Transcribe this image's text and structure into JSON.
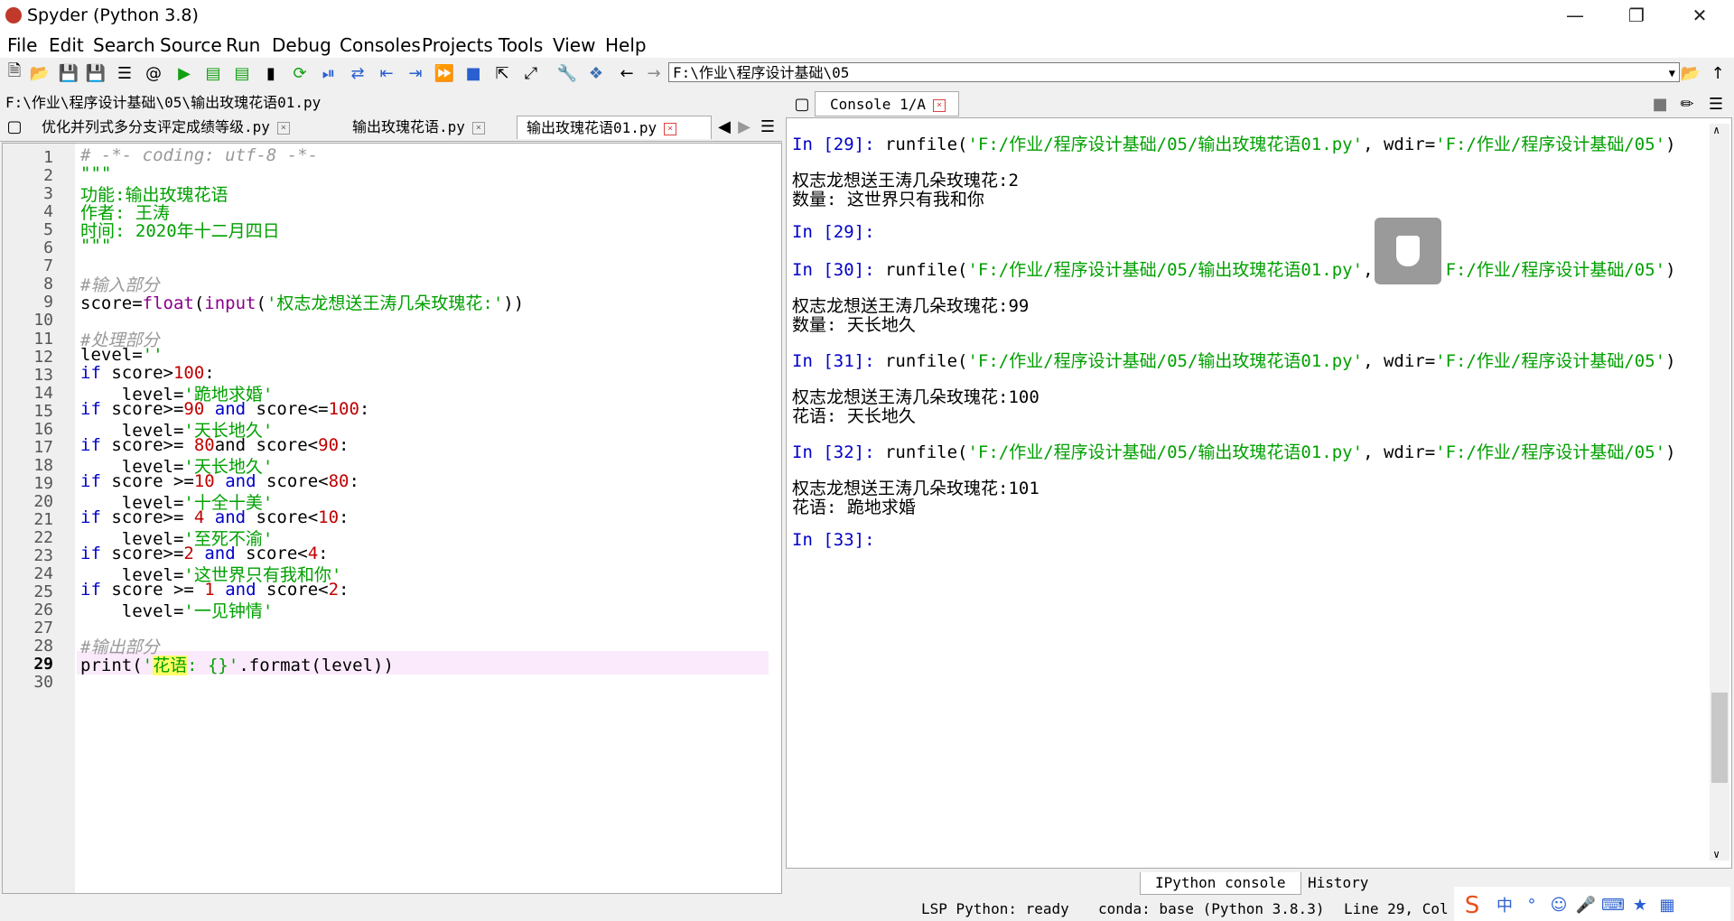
{
  "window": {
    "title": "Spyder (Python 3.8)"
  },
  "menu": [
    "File",
    "Edit",
    "Search",
    "Source",
    "Run",
    "Debug",
    "Consoles",
    "Projects",
    "Tools",
    "View",
    "Help"
  ],
  "toolbar": {
    "path": "F:\\作业\\程序设计基础\\05"
  },
  "editor": {
    "file_path": "F:\\作业\\程序设计基础\\05\\输出玫瑰花语01.py",
    "tabs": [
      {
        "label": "优化并列式多分支评定成绩等级.py",
        "active": false
      },
      {
        "label": "输出玫瑰花语.py",
        "active": false
      },
      {
        "label": "输出玫瑰花语01.py",
        "active": true
      }
    ],
    "current_line": 29,
    "lines": [
      "# -*- coding: utf-8 -*-",
      "\"\"\"",
      "功能:输出玫瑰花语",
      "作者: 王涛",
      "时间: 2020年十二月四日",
      "\"\"\"",
      "",
      "#输入部分",
      "score=float(input('权志龙想送王涛几朵玫瑰花:'))",
      "",
      "#处理部分",
      "level=''",
      "if score>100:",
      "    level='跪地求婚'",
      "if score>=90 and score<=100:",
      "    level='天长地久'",
      "if score>= 80and score<90:",
      "    level='天长地久'",
      "if score >=10 and score<80:",
      "    level='十全十美'",
      "if score>= 4 and score<10:",
      "    level='至死不渝'",
      "if score>=2 and score<4:",
      "    level='这世界只有我和你'",
      "if score >= 1 and score<2:",
      "    level='一见钟情'",
      "",
      "#输出部分",
      "print('花语: {}'.format(level))",
      ""
    ]
  },
  "console": {
    "tab_label": "Console 1/A",
    "lines": [
      {
        "prompt": "In [29]: ",
        "text": "runfile(",
        "s1": "'F:/作业/程序设计基础/05/输出玫瑰花语01.py'",
        "mid": ", wdir=",
        "s2": "'F:/作业/程序设计基础/05'",
        "end": ")"
      },
      {
        "text": "权志龙想送王涛几朵玫瑰花:2"
      },
      {
        "text": "数量: 这世界只有我和你"
      },
      {
        "prompt": "In [29]: "
      },
      {
        "prompt": "In [30]: ",
        "text": "runfile(",
        "s1": "'F:/作业/程序设计基础/05/输出玫瑰花语01.py'",
        "mid": ", wdir=",
        "s2": "'F:/作业/程序设计基础/05'",
        "end": ")"
      },
      {
        "text": "权志龙想送王涛几朵玫瑰花:99"
      },
      {
        "text": "数量: 天长地久"
      },
      {
        "prompt": "In [31]: ",
        "text": "runfile(",
        "s1": "'F:/作业/程序设计基础/05/输出玫瑰花语01.py'",
        "mid": ", wdir=",
        "s2": "'F:/作业/程序设计基础/05'",
        "end": ")"
      },
      {
        "text": "权志龙想送王涛几朵玫瑰花:100"
      },
      {
        "text": "花语: 天长地久"
      },
      {
        "prompt": "In [32]: ",
        "text": "runfile(",
        "s1": "'F:/作业/程序设计基础/05/输出玫瑰花语01.py'",
        "mid": ", wdir=",
        "s2": "'F:/作业/程序设计基础/05'",
        "end": ")"
      },
      {
        "text": "权志龙想送王涛几朵玫瑰花:101"
      },
      {
        "text": "花语: 跪地求婚"
      },
      {
        "prompt": "In [33]: "
      }
    ]
  },
  "bottom_tabs": [
    {
      "label": "IPython console",
      "active": true
    },
    {
      "label": "History",
      "active": false
    }
  ],
  "status": {
    "lsp": "LSP Python: ready",
    "conda": "conda: base (Python 3.8.3)",
    "cursor": "Line 29, Col 1"
  }
}
